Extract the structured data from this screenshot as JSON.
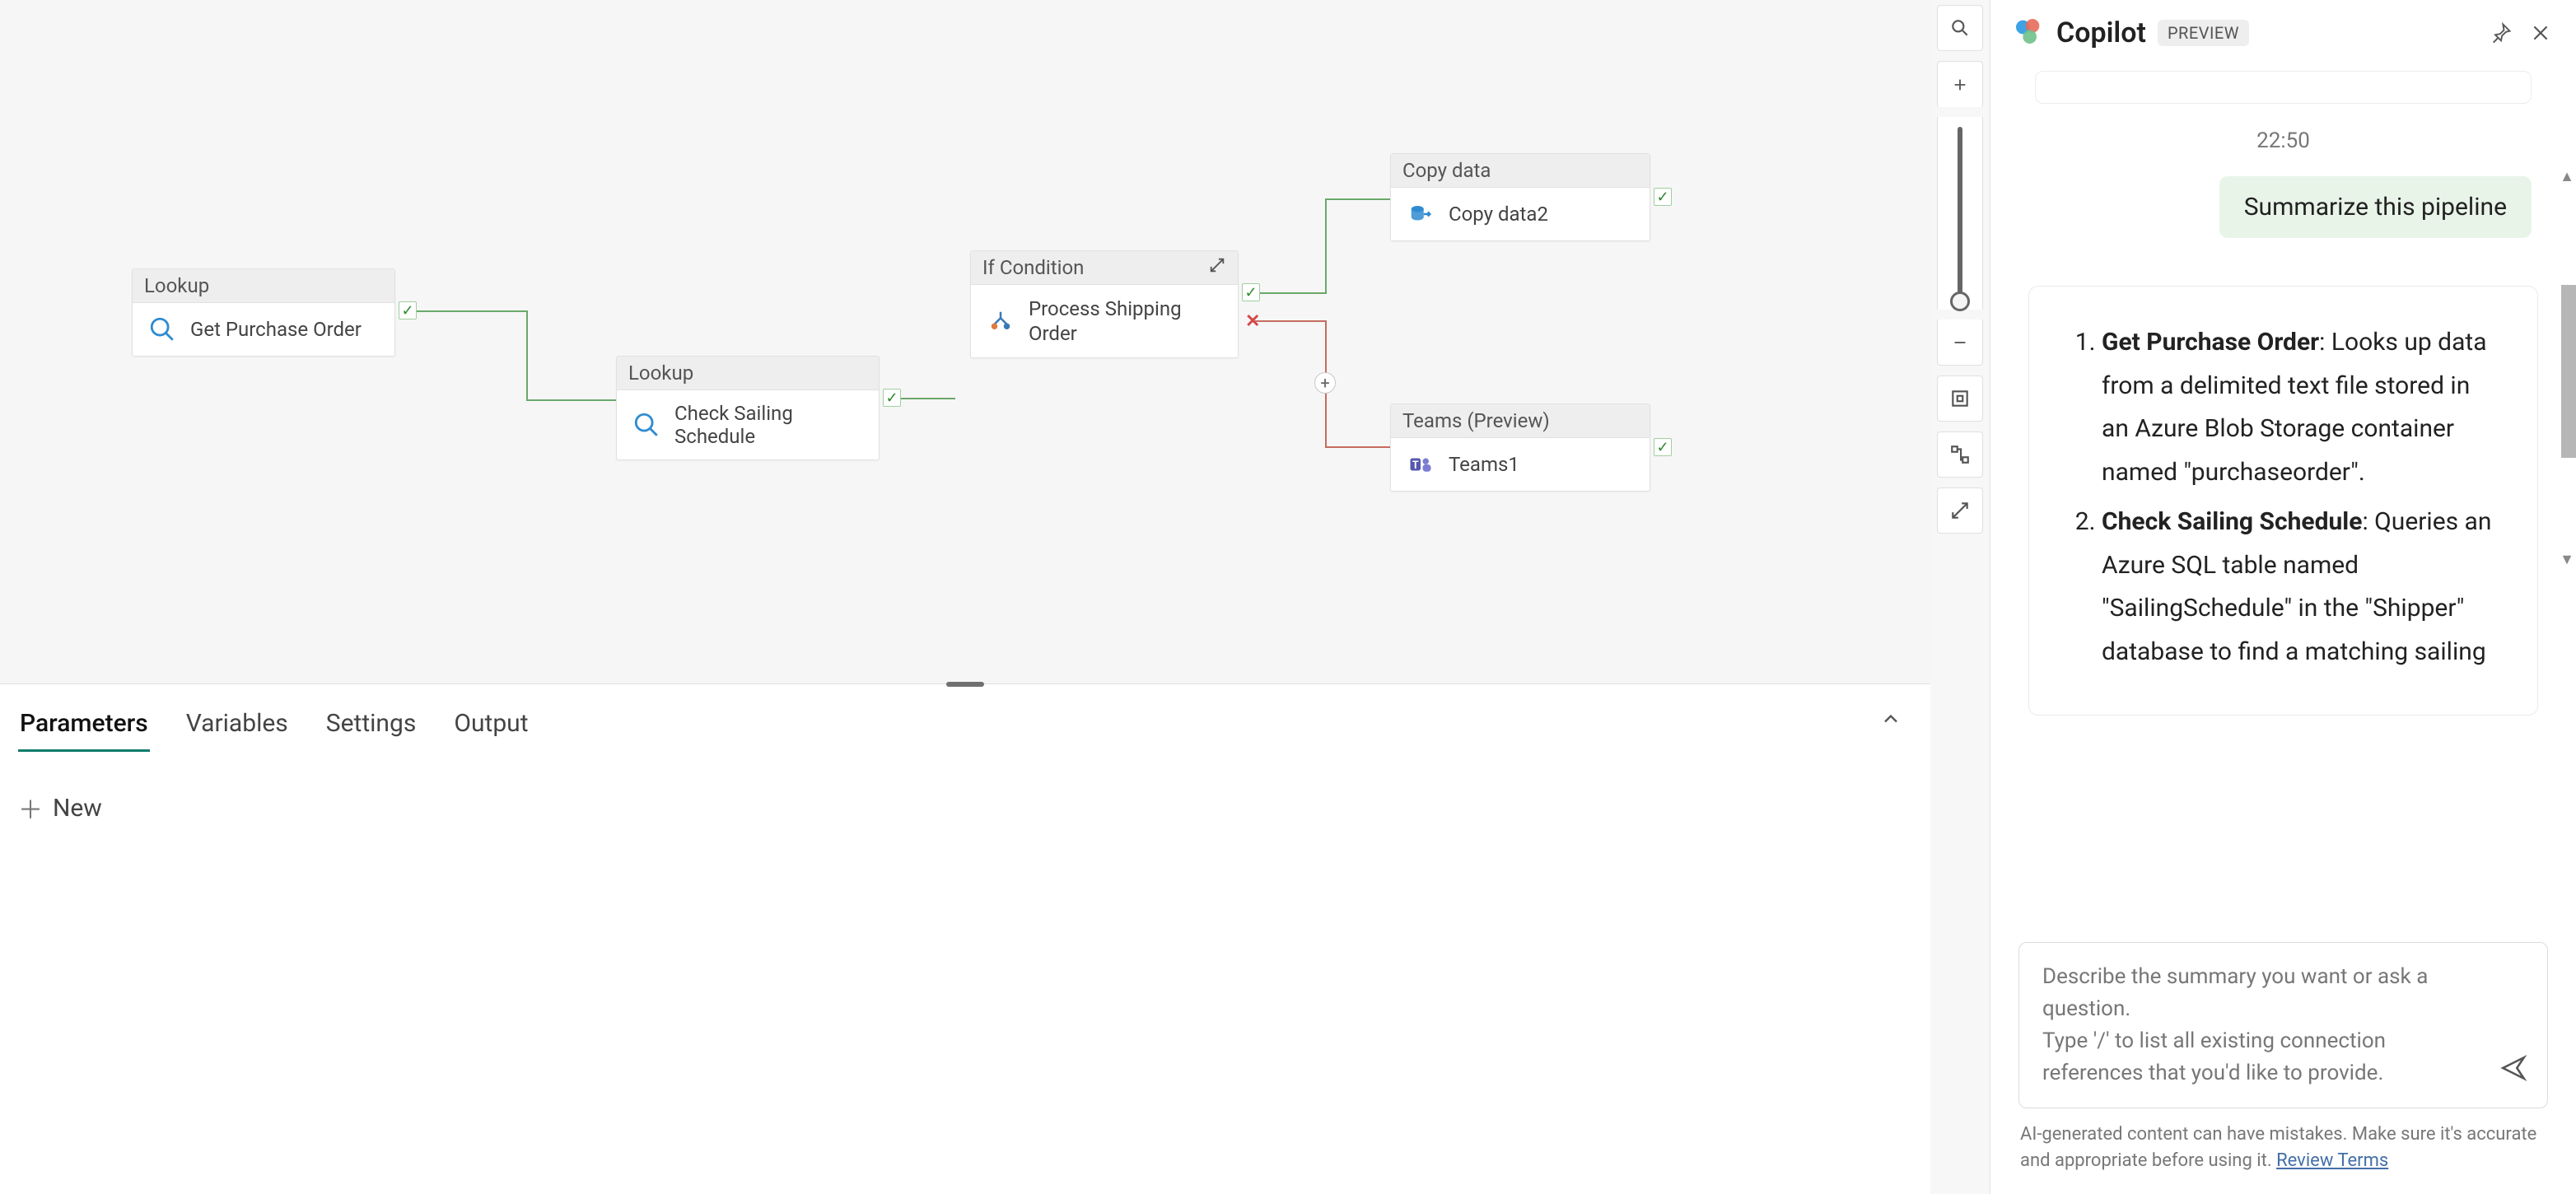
{
  "canvas": {
    "activities": {
      "get_po": {
        "type": "Lookup",
        "name": "Get Purchase Order"
      },
      "sailing": {
        "type": "Lookup",
        "name": "Check Sailing Schedule"
      },
      "ifcond": {
        "type": "If Condition",
        "name": "Process Shipping Order"
      },
      "copy": {
        "type": "Copy data",
        "name": "Copy data2"
      },
      "teams": {
        "type": "Teams (Preview)",
        "name": "Teams1"
      }
    }
  },
  "prop_panel": {
    "tabs": {
      "parameters": "Parameters",
      "variables": "Variables",
      "settings": "Settings",
      "output": "Output"
    },
    "new_label": "New"
  },
  "copilot": {
    "title": "Copilot",
    "badge": "PREVIEW",
    "timestamp": "22:50",
    "user_msg": "Summarize this pipeline",
    "steps": [
      {
        "title": "Get Purchase Order",
        "body": ": Looks up data from a delimited text file stored in an Azure Blob Storage container named \"purchaseorder\"."
      },
      {
        "title": "Check Sailing Schedule",
        "body": ": Queries an Azure SQL table named \"SailingSchedule\" in the \"Shipper\" database to find a matching sailing"
      }
    ],
    "input_placeholder": "Describe the summary you want or ask a question.\nType '/' to list all existing connection references that you'd like to provide.",
    "disclaimer_text": "AI-generated content can have mistakes. Make sure it's accurate and appropriate before using it. ",
    "disclaimer_link": "Review Terms"
  }
}
